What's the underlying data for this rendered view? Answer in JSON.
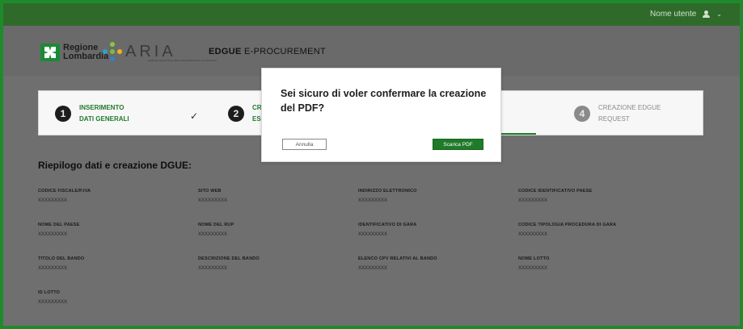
{
  "topbar": {
    "username": "Nome utente"
  },
  "header": {
    "logo_rl_line1": "Regione",
    "logo_rl_line2": "Lombardia",
    "logo_aria": "ARIA",
    "logo_aria_sub": "AZIENDA REGIONALE PER L'INNOVAZIONE E GLI ACQUISTI",
    "title_bold": "EDGUE",
    "title_rest": " E-PROCUREMENT"
  },
  "stepper": {
    "steps": [
      {
        "num": "1",
        "line1": "INSERIMENTO",
        "line2": "DATI GENERALI"
      },
      {
        "num": "2",
        "line1": "CR",
        "line2": "ES"
      },
      {
        "num": "4",
        "line1": "CREAZIONE EDGUE",
        "line2": "REQUEST"
      }
    ],
    "check": "✓"
  },
  "summary": {
    "title": "Riepilogo dati e creazione DGUE:",
    "fields": [
      {
        "label": "CODICE FISCALE/P.IVA",
        "value": "XXXXXXXXX"
      },
      {
        "label": "SITO WEB",
        "value": "XXXXXXXXX"
      },
      {
        "label": "INDIRIZZO ELETTRONICO",
        "value": "XXXXXXXXX"
      },
      {
        "label": "CODICE IDENTIFICATIVO PAESE",
        "value": "XXXXXXXXX"
      },
      {
        "label": "NOME DEL PAESE",
        "value": "XXXXXXXXX"
      },
      {
        "label": "NOME DEL RUP",
        "value": "XXXXXXXXX"
      },
      {
        "label": "IDENTIFICATIVO DI GARA",
        "value": "XXXXXXXXX"
      },
      {
        "label": "CODICE TIPOLOGIA PROCEDURA DI GARA",
        "value": "XXXXXXXXX"
      },
      {
        "label": "TITOLO DEL BANDO",
        "value": "XXXXXXXXX"
      },
      {
        "label": "DESCRIZIONE DEL BANDO",
        "value": "XXXXXXXXX"
      },
      {
        "label": "ELENCO CPV RELATIVI AL BANDO",
        "value": "XXXXXXXXX"
      },
      {
        "label": "NOME LOTTO",
        "value": "XXXXXXXXX"
      },
      {
        "label": "ID LOTTO",
        "value": "XXXXXXXXX"
      }
    ]
  },
  "modal": {
    "title": "Sei sicuro di voler confermare la creazione del PDF?",
    "cancel_label": "Annulla",
    "confirm_label": "Scarica PDF"
  },
  "colors": {
    "brand_green": "#1f7a2a",
    "topbar_green": "#2f6a2b",
    "border_green": "#1f8a2c"
  }
}
